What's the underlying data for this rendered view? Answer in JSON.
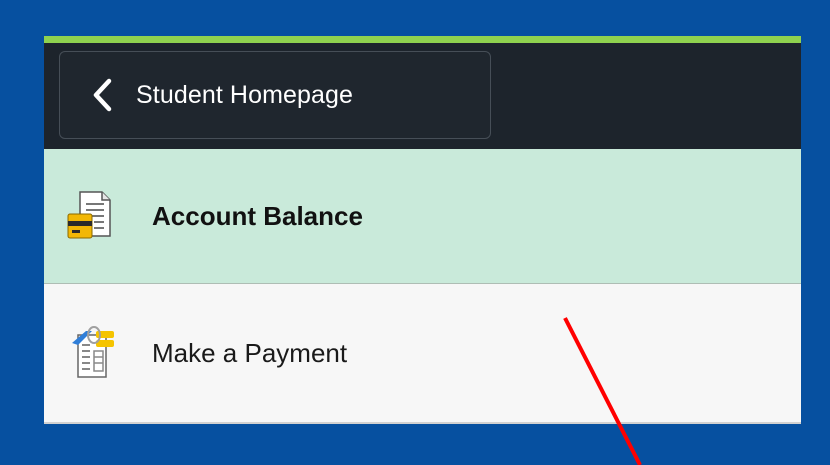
{
  "header": {
    "back_label": "Student Homepage",
    "back_icon": "chevron-left-icon"
  },
  "nav": {
    "items": [
      {
        "label": "Account Balance",
        "icon": "account-balance-icon",
        "active": true
      },
      {
        "label": "Make a Payment",
        "icon": "make-payment-icon",
        "active": false
      }
    ]
  },
  "colors": {
    "page_background": "#0650a0",
    "accent_bar": "#8fd24f",
    "header_background": "#1d242c",
    "active_item_background": "#c9eada",
    "item_background": "#f7f7f7",
    "annotation": "#ff0000"
  }
}
